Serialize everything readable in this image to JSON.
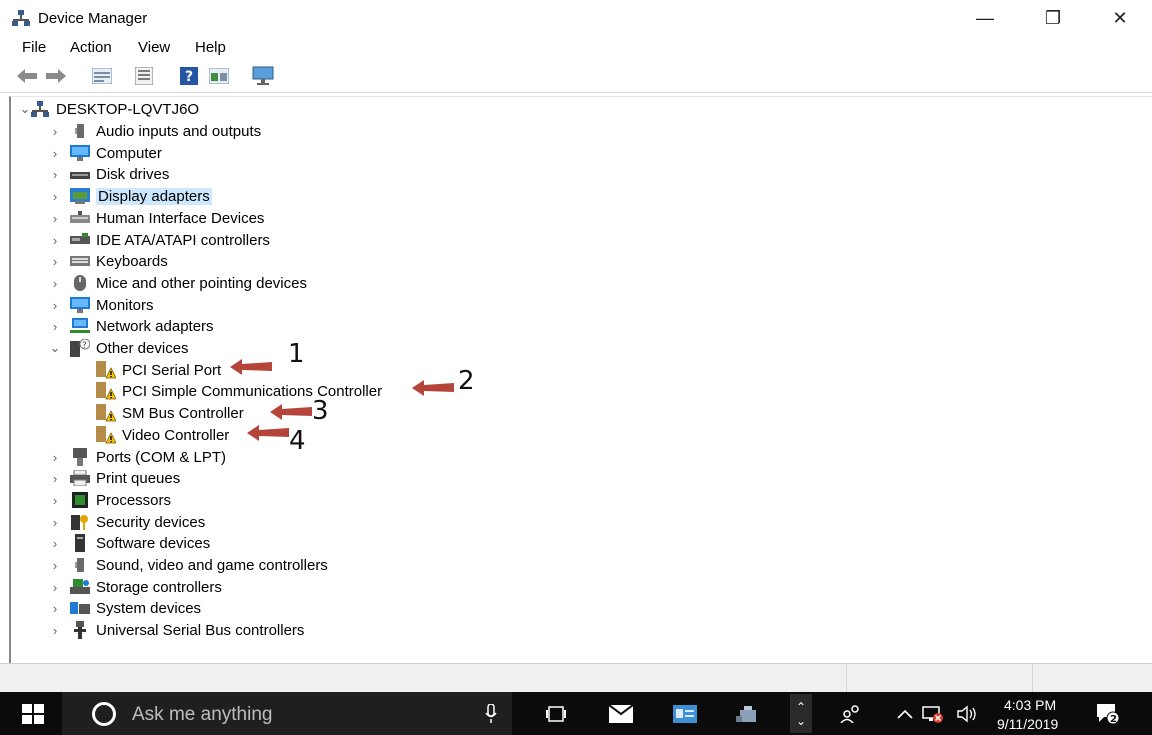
{
  "window": {
    "title": "Device Manager",
    "controls": {
      "minimize": "—",
      "restore": "❐",
      "close": "✕"
    }
  },
  "menu": [
    "File",
    "Action",
    "View",
    "Help"
  ],
  "toolbar": {
    "buttons": [
      "back-arrow-icon",
      "forward-arrow-icon",
      "properties-view-icon",
      "device-list-icon",
      "help-icon",
      "update-driver-icon",
      "scan-hardware-icon"
    ]
  },
  "tree": {
    "root": "DESKTOP-LQVTJ6O",
    "categories": [
      {
        "label": "Audio inputs and outputs",
        "icon": "speaker-icon"
      },
      {
        "label": "Computer",
        "icon": "computer-icon"
      },
      {
        "label": "Disk drives",
        "icon": "disk-drive-icon"
      },
      {
        "label": "Display adapters",
        "icon": "display-adapter-icon",
        "selected": true
      },
      {
        "label": "Human Interface Devices",
        "icon": "hid-icon"
      },
      {
        "label": "IDE ATA/ATAPI controllers",
        "icon": "ide-controller-icon"
      },
      {
        "label": "Keyboards",
        "icon": "keyboard-icon"
      },
      {
        "label": "Mice and other pointing devices",
        "icon": "mouse-icon"
      },
      {
        "label": "Monitors",
        "icon": "monitor-icon"
      },
      {
        "label": "Network adapters",
        "icon": "network-adapter-icon"
      },
      {
        "label": "Other devices",
        "icon": "unknown-device-icon",
        "expanded": true
      }
    ],
    "other_devices": [
      {
        "label": "PCI Serial Port",
        "annotation": "1"
      },
      {
        "label": "PCI Simple Communications Controller",
        "annotation": "2"
      },
      {
        "label": "SM Bus Controller",
        "annotation": "3"
      },
      {
        "label": "Video Controller",
        "annotation": "4"
      }
    ],
    "categories_after": [
      {
        "label": "Ports (COM & LPT)",
        "icon": "port-icon"
      },
      {
        "label": "Print queues",
        "icon": "printer-icon"
      },
      {
        "label": "Processors",
        "icon": "processor-icon"
      },
      {
        "label": "Security devices",
        "icon": "security-device-icon"
      },
      {
        "label": "Software devices",
        "icon": "software-device-icon"
      },
      {
        "label": "Sound, video and game controllers",
        "icon": "sound-icon"
      },
      {
        "label": "Storage controllers",
        "icon": "storage-controller-icon"
      },
      {
        "label": "System devices",
        "icon": "system-devices-icon"
      },
      {
        "label": "Universal Serial Bus controllers",
        "icon": "usb-icon"
      }
    ]
  },
  "taskbar": {
    "search_placeholder": "Ask me anything",
    "time": "4:03 PM",
    "date": "9/11/2019",
    "notification_count": "2"
  },
  "colors": {
    "selection": "#cce8ff",
    "annotation_arrow": "#b5443a",
    "taskbar": "#0b0b0b"
  }
}
